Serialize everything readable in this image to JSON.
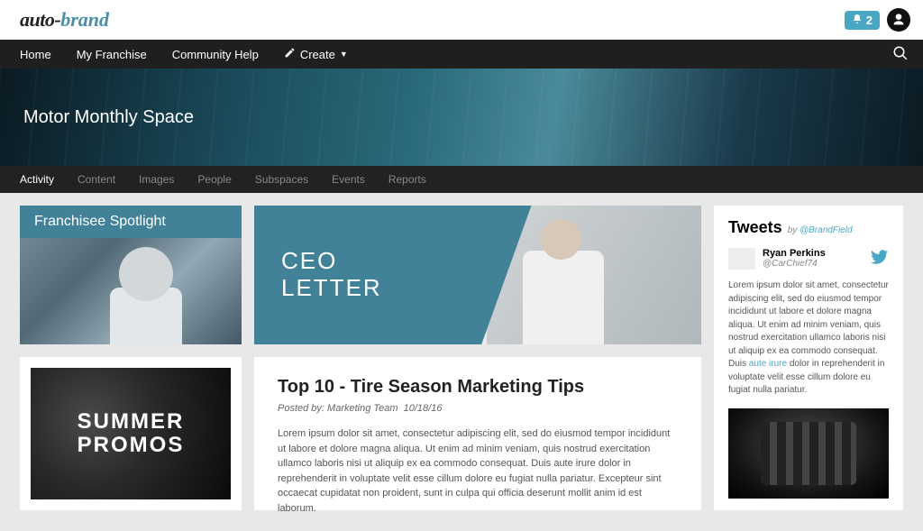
{
  "brand": {
    "part1": "auto-",
    "part2": "brand"
  },
  "notifications": {
    "count": "2"
  },
  "nav": {
    "home": "Home",
    "franchise": "My Franchise",
    "community": "Community Help",
    "create": "Create"
  },
  "hero": {
    "title": "Motor Monthly Space"
  },
  "subnav": {
    "items": [
      {
        "label": "Activity",
        "active": true
      },
      {
        "label": "Content"
      },
      {
        "label": "Images"
      },
      {
        "label": "People"
      },
      {
        "label": "Subspaces"
      },
      {
        "label": "Events"
      },
      {
        "label": "Reports"
      }
    ]
  },
  "spotlight": {
    "title": "Franchisee Spotlight"
  },
  "promos": {
    "line1": "SUMMER",
    "line2": "PROMOS"
  },
  "ceo": {
    "line1": "CEO",
    "line2": "LETTER"
  },
  "article": {
    "title": "Top 10 - Tire Season Marketing Tips",
    "posted_by_label": "Posted by:",
    "author": "Marketing Team",
    "date": "10/18/16",
    "body": "Lorem ipsum dolor sit amet, consectetur adipiscing elit, sed do eiusmod tempor incididunt ut labore et dolore magna aliqua. Ut enim ad minim veniam, quis nostrud exercitation ullamco laboris nisi ut aliquip ex ea commodo consequat. Duis aute irure dolor in reprehenderit in voluptate velit esse cillum dolore eu fugiat nulla pariatur. Excepteur sint occaecat cupidatat non proident, sunt in culpa qui officia deserunt mollit anim id est laborum."
  },
  "tweets": {
    "title": "Tweets",
    "by_label": "by",
    "by_handle": "@BrandField",
    "user_name": "Ryan Perkins",
    "user_handle": "@CarChief74",
    "body_pre": "Lorem ipsum dolor sit amet, consectetur adipiscing elit, sed do eiusmod tempor incididunt ut labore et dolore magna aliqua. Ut enim ad minim veniam, quis nostrud exercitation ullamco laboris nisi ut aliquip ex ea commodo consequat. Duis ",
    "body_link": "aute irure",
    "body_post": " dolor in reprehenderit in voluptate velit esse cillum dolore eu fugiat nulla pariatur."
  }
}
